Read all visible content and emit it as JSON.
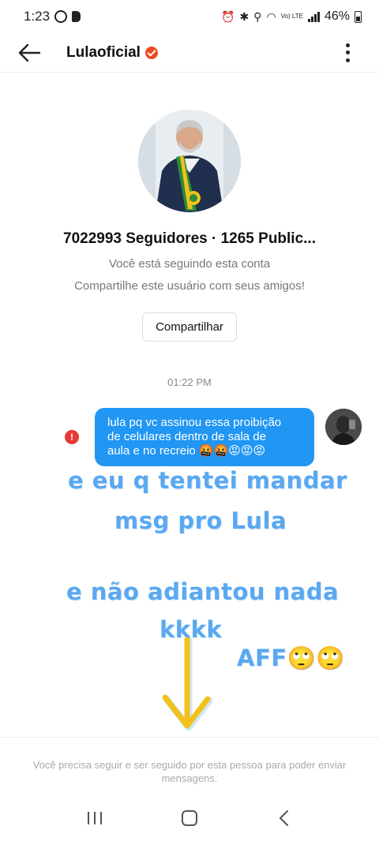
{
  "status_bar": {
    "time": "1:23",
    "battery": "46%",
    "network": "Vo) LTE"
  },
  "header": {
    "title": "Lulaoficial"
  },
  "profile": {
    "stats": "7022993 Seguidores · 1265 Public...",
    "following_text": "Você está seguindo esta conta",
    "share_prompt": "Compartilhe este usuário com seus amigos!",
    "share_button": "Compartilhar"
  },
  "chat": {
    "timestamp": "01:22 PM",
    "message_line1": "lula pq vc assinou essa proibição",
    "message_line2": "de celulares dentro de sala de",
    "message_line3": "aula e no recreio 🤬🤬😡😡😡",
    "error_mark": "!"
  },
  "overlay": {
    "line1": "e eu q tentei mandar",
    "line2": "msg pro Lula",
    "line3": "e não adiantou nada",
    "line4": "kkkk",
    "line5": "AFF🙄🙄"
  },
  "footer": {
    "notice": "Você precisa seguir e ser seguido por esta pessoa para poder enviar mensagens."
  },
  "colors": {
    "bubble": "#2196f3",
    "overlay_text": "#5aa8f0",
    "verified": "#ee4a23",
    "arrow": "#f2c21b"
  }
}
